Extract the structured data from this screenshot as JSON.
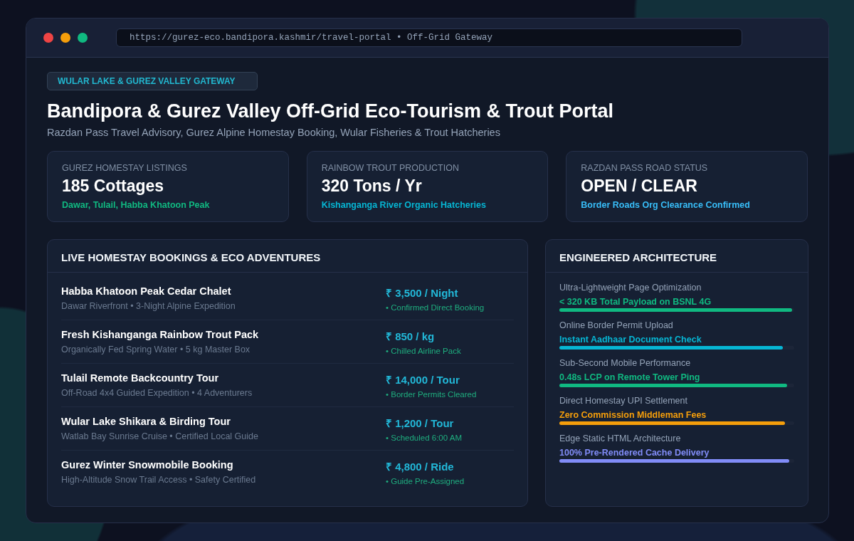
{
  "browser": {
    "address": "https://gurez-eco.bandipora.kashmir/travel-portal • Off-Grid Gateway"
  },
  "badge": "WULAR LAKE & GUREZ VALLEY GATEWAY",
  "title": "Bandipora & Gurez Valley Off-Grid Eco-Tourism & Trout Portal",
  "subtitle": "Razdan Pass Travel Advisory, Gurez Alpine Homestay Booking, Wular Fisheries & Trout Hatcheries",
  "stats": [
    {
      "label": "GUREZ HOMESTAY LISTINGS",
      "value": "185 Cottages",
      "note": "Dawar, Tulail, Habba Khatoon Peak",
      "color": "#10b981"
    },
    {
      "label": "RAINBOW TROUT PRODUCTION",
      "value": "320 Tons / Yr",
      "note": "Kishanganga River Organic Hatcheries",
      "color": "#06b6d4"
    },
    {
      "label": "RAZDAN PASS ROAD STATUS",
      "value": "OPEN / CLEAR",
      "note": "Border Roads Org Clearance Confirmed",
      "color": "#38bdf8"
    }
  ],
  "bookings": {
    "title": "LIVE HOMESTAY BOOKINGS & ECO ADVENTURES",
    "rows": [
      {
        "name": "Habba Khatoon Peak Cedar Chalet",
        "detail": "Dawar Riverfront • 3-Night Alpine Expedition",
        "price": "₹ 3,500 / Night",
        "status": "• Confirmed Direct Booking"
      },
      {
        "name": "Fresh Kishanganga Rainbow Trout Pack",
        "detail": "Organically Fed Spring Water • 5 kg Master Box",
        "price": "₹ 850 / kg",
        "status": "• Chilled Airline Pack"
      },
      {
        "name": "Tulail Remote Backcountry Tour",
        "detail": "Off-Road 4x4 Guided Expedition • 4 Adventurers",
        "price": "₹ 14,000 / Tour",
        "status": "• Border Permits Cleared"
      },
      {
        "name": "Wular Lake Shikara & Birding Tour",
        "detail": "Watlab Bay Sunrise Cruise • Certified Local Guide",
        "price": "₹ 1,200 / Tour",
        "status": "• Scheduled 6:00 AM"
      },
      {
        "name": "Gurez Winter Snowmobile Booking",
        "detail": "High-Altitude Snow Trail Access • Safety Certified",
        "price": "₹ 4,800 / Ride",
        "status": "• Guide Pre-Assigned"
      }
    ]
  },
  "architecture": {
    "title": "ENGINEERED ARCHITECTURE",
    "metrics": [
      {
        "label": "Ultra-Lightweight Page Optimization",
        "value": "< 320 KB Total Payload on BSNL 4G",
        "level": 0.99,
        "color": "#10b981"
      },
      {
        "label": "Online Border Permit Upload",
        "value": "Instant Aadhaar Document Check",
        "level": 0.95,
        "color": "#06b6d4"
      },
      {
        "label": "Sub-Second Mobile Performance",
        "value": "0.48s LCP on Remote Tower Ping",
        "level": 0.97,
        "color": "#10b981"
      },
      {
        "label": "Direct Homestay UPI Settlement",
        "value": "Zero Commission Middleman Fees",
        "level": 0.96,
        "color": "#f59e0b"
      },
      {
        "label": "Edge Static HTML Architecture",
        "value": "100% Pre-Rendered Cache Delivery",
        "level": 0.98,
        "color": "#818cf8"
      }
    ]
  }
}
